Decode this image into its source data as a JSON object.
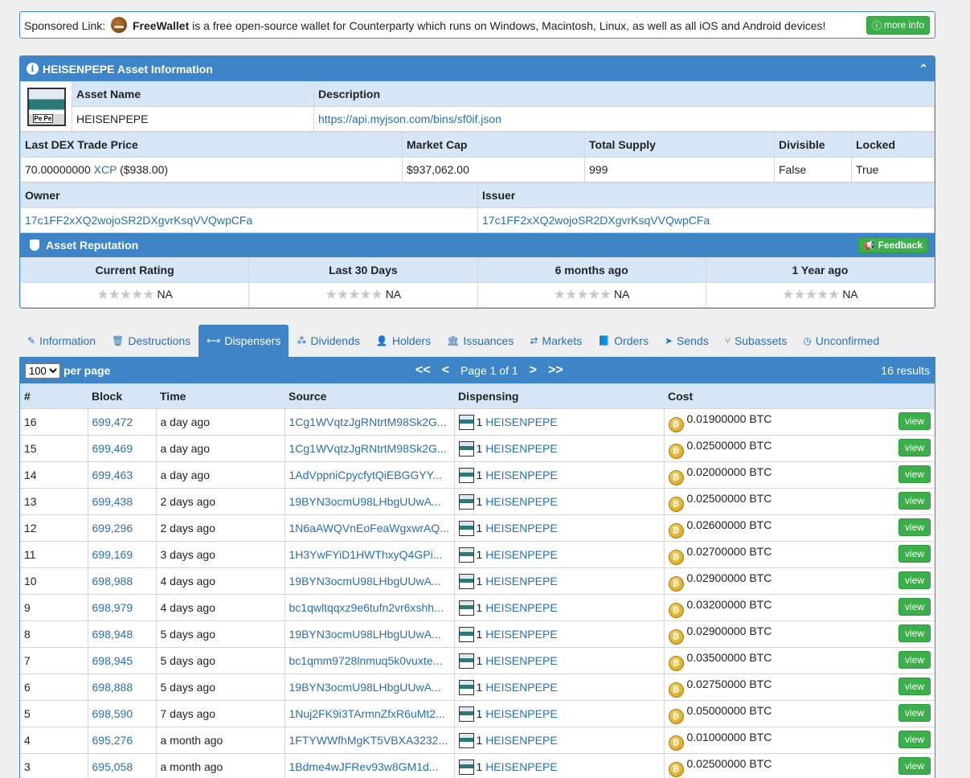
{
  "sponsor": {
    "prefix": "Sponsored Link:",
    "brand": "FreeWallet",
    "text": "is a free open-source wallet for Counterparty which runs on Windows, Macintosh, Linux, as well as all iOS and Android devices!",
    "button": "more info"
  },
  "asset": {
    "title": "HEISENPEPE Asset Information",
    "asset_name_label": "Asset Name",
    "asset_name": "HEISENPEPE",
    "description_label": "Description",
    "description": "https://api.myjson.com/bins/sf0if.json",
    "price_label": "Last DEX Trade Price",
    "price_value": "70.00000000",
    "price_unit": "XCP",
    "price_usd": "($938.00)",
    "market_cap_label": "Market Cap",
    "market_cap": "$937,062.00",
    "supply_label": "Total Supply",
    "supply": "999",
    "divisible_label": "Divisible",
    "divisible": "False",
    "locked_label": "Locked",
    "locked": "True",
    "owner_label": "Owner",
    "owner": "17c1FF2xXQ2wojoSR2DXgvrKsqVVQwpCFa",
    "issuer_label": "Issuer",
    "issuer": "17c1FF2xXQ2wojoSR2DXgvrKsqVVQwpCFa"
  },
  "reputation": {
    "title": "Asset Reputation",
    "feedback": "Feedback",
    "columns": [
      "Current Rating",
      "Last 30 Days",
      "6 months ago",
      "1 Year ago"
    ],
    "stars": "★★★★★",
    "values": [
      "NA",
      "NA",
      "NA",
      "NA"
    ]
  },
  "tabs": [
    {
      "icon": "✎",
      "label": "Information"
    },
    {
      "icon": "🗑",
      "label": "Destructions"
    },
    {
      "icon": "⟷",
      "label": "Dispensers"
    },
    {
      "icon": "⁂",
      "label": "Dividends"
    },
    {
      "icon": "👤",
      "label": "Holders"
    },
    {
      "icon": "🏛",
      "label": "Issuances"
    },
    {
      "icon": "⇄",
      "label": "Markets"
    },
    {
      "icon": "📘",
      "label": "Orders"
    },
    {
      "icon": "➤",
      "label": "Sends"
    },
    {
      "icon": "⑂",
      "label": "Subassets"
    },
    {
      "icon": "◷",
      "label": "Unconfirmed"
    }
  ],
  "active_tab": "Dispensers",
  "dispensers": {
    "per_page_value": "100",
    "per_page_label": "per page",
    "pager_first": "<<",
    "pager_prev": "<",
    "page_text": "Page 1 of 1",
    "pager_next": ">",
    "pager_last": ">>",
    "results": "16 results",
    "columns": [
      "#",
      "Block",
      "Time",
      "Source",
      "Dispensing",
      "Cost"
    ],
    "view_label": "view",
    "rows": [
      {
        "n": "16",
        "block": "699,472",
        "time": "a day ago",
        "source": "1Cg1WVqtzJgRNtrtM98Sk2G...",
        "qty": "1",
        "asset": "HEISENPEPE",
        "cost": "0.01900000 BTC"
      },
      {
        "n": "15",
        "block": "699,469",
        "time": "a day ago",
        "source": "1Cg1WVqtzJgRNtrtM98Sk2G...",
        "qty": "1",
        "asset": "HEISENPEPE",
        "cost": "0.02500000 BTC"
      },
      {
        "n": "14",
        "block": "699,463",
        "time": "a day ago",
        "source": "1AdVppniCpycfytQiEBGGYY...",
        "qty": "1",
        "asset": "HEISENPEPE",
        "cost": "0.02000000 BTC"
      },
      {
        "n": "13",
        "block": "699,438",
        "time": "2 days ago",
        "source": "19BYN3ocmU98LHbgUUwA...",
        "qty": "1",
        "asset": "HEISENPEPE",
        "cost": "0.02500000 BTC"
      },
      {
        "n": "12",
        "block": "699,296",
        "time": "2 days ago",
        "source": "1N6aAWQVnEoFeaWgxwrAQ...",
        "qty": "1",
        "asset": "HEISENPEPE",
        "cost": "0.02600000 BTC"
      },
      {
        "n": "11",
        "block": "699,169",
        "time": "3 days ago",
        "source": "1H3YwFYiD1HWThxyQ4GPi...",
        "qty": "1",
        "asset": "HEISENPEPE",
        "cost": "0.02700000 BTC"
      },
      {
        "n": "10",
        "block": "698,988",
        "time": "4 days ago",
        "source": "19BYN3ocmU98LHbgUUwA...",
        "qty": "1",
        "asset": "HEISENPEPE",
        "cost": "0.02900000 BTC"
      },
      {
        "n": "9",
        "block": "698,979",
        "time": "4 days ago",
        "source": "bc1qwltqqxz9e6tufn2vr6xshh...",
        "qty": "1",
        "asset": "HEISENPEPE",
        "cost": "0.03200000 BTC"
      },
      {
        "n": "8",
        "block": "698,948",
        "time": "5 days ago",
        "source": "19BYN3ocmU98LHbgUUwA...",
        "qty": "1",
        "asset": "HEISENPEPE",
        "cost": "0.02900000 BTC"
      },
      {
        "n": "7",
        "block": "698,945",
        "time": "5 days ago",
        "source": "bc1qmm9728lnmuq5k0vuxte...",
        "qty": "1",
        "asset": "HEISENPEPE",
        "cost": "0.03500000 BTC"
      },
      {
        "n": "6",
        "block": "698,888",
        "time": "5 days ago",
        "source": "19BYN3ocmU98LHbgUUwA...",
        "qty": "1",
        "asset": "HEISENPEPE",
        "cost": "0.02750000 BTC"
      },
      {
        "n": "5",
        "block": "698,590",
        "time": "7 days ago",
        "source": "1Nuj2FK9i3TArmnZfxR6uMt2...",
        "qty": "1",
        "asset": "HEISENPEPE",
        "cost": "0.05000000 BTC"
      },
      {
        "n": "4",
        "block": "695,276",
        "time": "a month ago",
        "source": "1FTYWWfhMgKT5VBXA3232...",
        "qty": "1",
        "asset": "HEISENPEPE",
        "cost": "0.01000000 BTC"
      },
      {
        "n": "3",
        "block": "695,058",
        "time": "a month ago",
        "source": "1Bdme4wJFRev93w8GM1d...",
        "qty": "1",
        "asset": "HEISENPEPE",
        "cost": "0.02500000 BTC"
      }
    ]
  }
}
